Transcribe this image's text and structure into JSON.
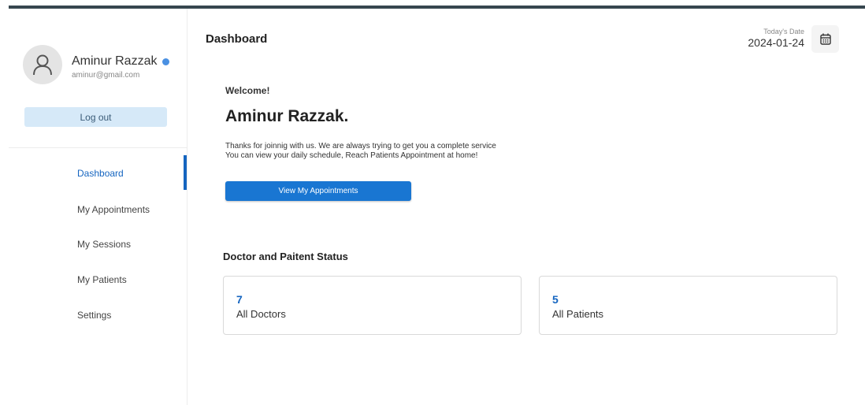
{
  "user": {
    "name": "Aminur Razzak",
    "email": "aminur@gmail.com",
    "logout_label": "Log out"
  },
  "sidebar": {
    "items": [
      {
        "label": "Dashboard",
        "active": true
      },
      {
        "label": "My Appointments",
        "active": false
      },
      {
        "label": "My Sessions",
        "active": false
      },
      {
        "label": "My Patients",
        "active": false
      },
      {
        "label": "Settings",
        "active": false
      }
    ]
  },
  "header": {
    "title": "Dashboard",
    "date_label": "Today's Date",
    "date_value": "2024-01-24",
    "calendar_icon": "calendar-icon"
  },
  "welcome": {
    "greeting": "Welcome!",
    "name": "Aminur Razzak.",
    "line1": "Thanks for joinnig with us. We are always trying to get you a complete service",
    "line2": "You can view your daily schedule, Reach Patients Appointment at home!",
    "button_label": "View My Appointments"
  },
  "status": {
    "title": "Doctor and Paitent Status",
    "cards": [
      {
        "count": "7",
        "label": "All Doctors"
      },
      {
        "count": "5",
        "label": "All Patients"
      }
    ]
  },
  "colors": {
    "accent": "#1976d2",
    "top_bar": "#37474f",
    "logout_bg": "#d6e9f8"
  }
}
